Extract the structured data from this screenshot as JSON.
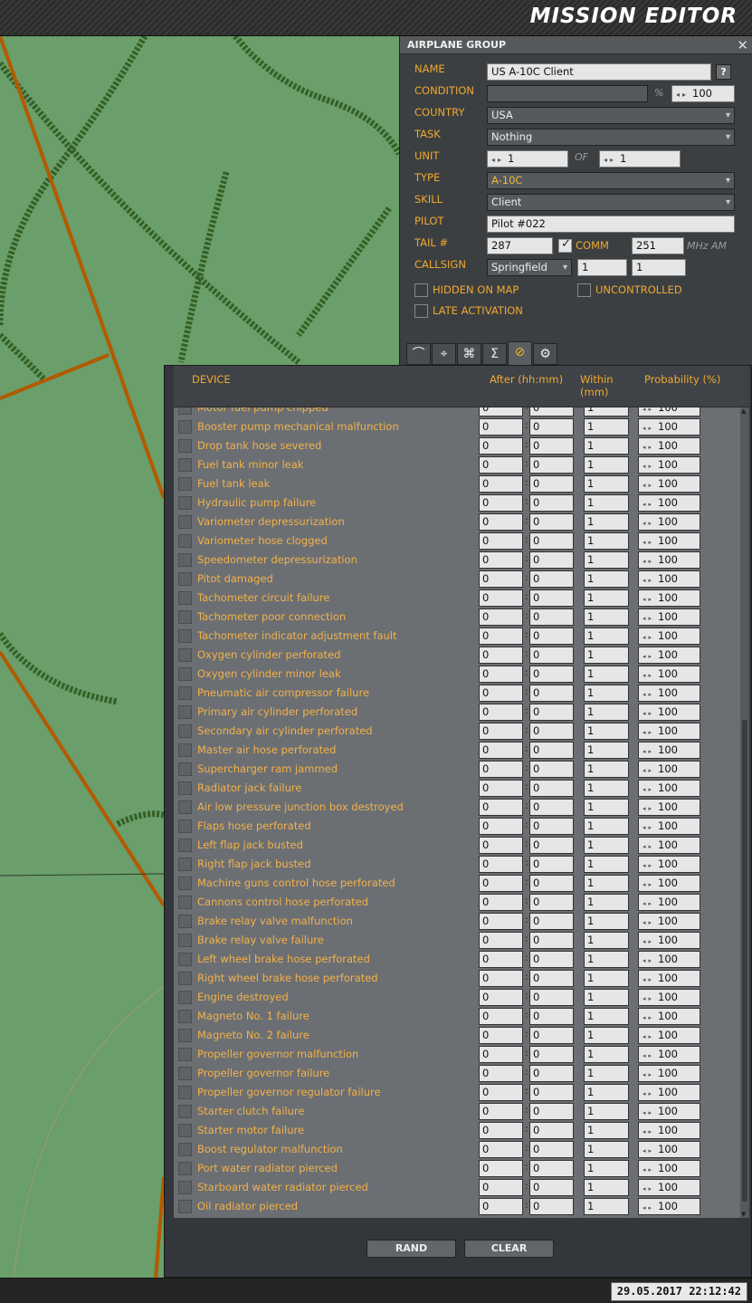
{
  "app": {
    "title": "MISSION EDITOR",
    "datetime": "29.05.2017 22:12:42"
  },
  "group": {
    "header": "AIRPLANE GROUP",
    "close_icon": "✕",
    "help_label": "?",
    "labels": {
      "name": "NAME",
      "condition": "CONDITION",
      "country": "COUNTRY",
      "task": "TASK",
      "unit": "UNIT",
      "type": "TYPE",
      "skill": "SKILL",
      "pilot": "PILOT",
      "tail": "TAIL #",
      "callsign": "CALLSIGN"
    },
    "name_value": "US A-10C Client",
    "condition_value": "",
    "percent_symbol": "%",
    "condition_probability": "100",
    "country_value": "USA",
    "task_value": "Nothing",
    "unit_value": "1",
    "of_label": "OF",
    "unit_of_value": "1",
    "type_value": "A-10C",
    "skill_value": "Client",
    "pilot_value": "Pilot #022",
    "tail_value": "287",
    "comm_label": "COMM",
    "comm_checked": true,
    "comm_value": "251",
    "comm_units": "MHz  AM",
    "callsign_value": "Springfield",
    "callsign_num1": "1",
    "callsign_num2": "1",
    "hidden_on_map_label": "HIDDEN ON MAP",
    "uncontrolled_label": "UNCONTROLLED",
    "late_activation_label": "LATE ACTIVATION"
  },
  "tabs": [
    {
      "icon": "route-icon",
      "glyph": "⌒"
    },
    {
      "icon": "target-icon",
      "glyph": "⌖"
    },
    {
      "icon": "payload-icon",
      "glyph": "⌘"
    },
    {
      "icon": "sigma-icon",
      "glyph": "Σ"
    },
    {
      "icon": "failures-icon",
      "glyph": "⊘"
    },
    {
      "icon": "settings-icon",
      "glyph": "⚙"
    }
  ],
  "failures": {
    "columns": {
      "device": "DEVICE",
      "after": "After (hh:mm)",
      "within": "Within\n(mm)",
      "probability": "Probability (%)"
    },
    "partial_first_row": "Motor fuel pump chipped",
    "rows": [
      "Booster pump mechanical malfunction",
      "Drop tank hose severed",
      "Fuel tank minor leak",
      "Fuel tank leak",
      "Hydraulic pump failure",
      "Variometer depressurization",
      "Variometer hose clogged",
      "Speedometer depressurization",
      "Pitot damaged",
      "Tachometer circuit failure",
      "Tachometer poor connection",
      "Tachometer indicator adjustment fault",
      "Oxygen cylinder perforated",
      "Oxygen cylinder minor leak",
      "Pneumatic air compressor failure",
      "Primary air cylinder perforated",
      "Secondary air cylinder perforated",
      "Master air hose perforated",
      "Supercharger ram jammed",
      "Radiator jack failure",
      "Air low pressure junction box destroyed",
      "Flaps hose perforated",
      "Left flap jack busted",
      "Right flap jack busted",
      "Machine guns control hose perforated",
      "Cannons control hose perforated",
      "Brake relay valve malfunction",
      "Brake relay valve failure",
      "Left wheel brake hose perforated",
      "Right wheel brake hose perforated",
      "Engine destroyed",
      "Magneto No. 1 failure",
      "Magneto No. 2 failure",
      "Propeller governor malfunction",
      "Propeller governor failure",
      "Propeller governor regulator failure",
      "Starter clutch failure",
      "Starter motor failure",
      "Boost regulator malfunction",
      "Port water radiator pierced",
      "Starboard water radiator pierced",
      "Oil radiator pierced"
    ],
    "default_after_h": "0",
    "default_after_m": "0",
    "default_within": "1",
    "default_probability": "100",
    "rand_label": "RAND",
    "clear_label": "CLEAR"
  }
}
